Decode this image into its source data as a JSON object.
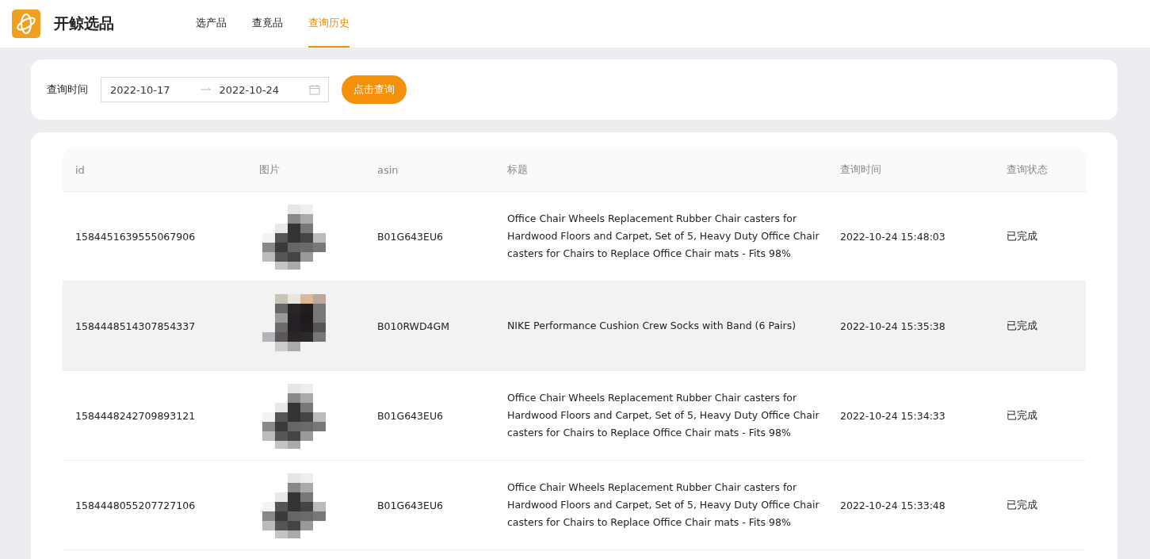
{
  "app": {
    "name": "开鲸选品"
  },
  "nav": [
    {
      "label": "选产品",
      "selected": false
    },
    {
      "label": "查竟品",
      "selected": false
    },
    {
      "label": "查询历史",
      "selected": true
    }
  ],
  "filter": {
    "label": "查询时间",
    "start": "2022-10-17",
    "end": "2022-10-24",
    "button": "点击查询"
  },
  "table": {
    "columns": [
      "id",
      "图片",
      "asin",
      "标题",
      "查询时间",
      "查询状态"
    ],
    "rows": [
      {
        "id": "1584451639555067906",
        "asin": "B01G643EU6",
        "title": "Office Chair Wheels Replacement Rubber Chair casters for Hardwood Floors and Carpet, Set of 5, Heavy Duty Office Chair casters for Chairs to Replace Office Chair mats - Fits 98%",
        "time": "2022-10-24 15:48:03",
        "status": "已完成",
        "selected": false
      },
      {
        "id": "1584448514307854337",
        "asin": "B010RWD4GM",
        "title": "NIKE Performance Cushion Crew Socks with Band (6 Pairs)",
        "time": "2022-10-24 15:35:38",
        "status": "已完成",
        "selected": true
      },
      {
        "id": "1584448242709893121",
        "asin": "B01G643EU6",
        "title": "Office Chair Wheels Replacement Rubber Chair casters for Hardwood Floors and Carpet, Set of 5, Heavy Duty Office Chair casters for Chairs to Replace Office Chair mats - Fits 98%",
        "time": "2022-10-24 15:34:33",
        "status": "已完成",
        "selected": false
      },
      {
        "id": "1584448055207727106",
        "asin": "B01G643EU6",
        "title": "Office Chair Wheels Replacement Rubber Chair casters for Hardwood Floors and Carpet, Set of 5, Heavy Duty Office Chair casters for Chairs to Replace Office Chair mats - Fits 98%",
        "time": "2022-10-24 15:33:48",
        "status": "已完成",
        "selected": false
      }
    ]
  }
}
